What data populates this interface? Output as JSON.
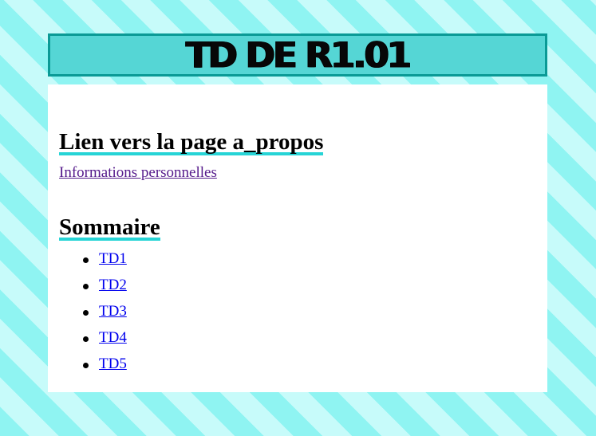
{
  "banner": {
    "title": "TD DE R1.01"
  },
  "section_link": {
    "heading": "Lien vers la page a_propos",
    "link_label": "Informations personnelles"
  },
  "summary": {
    "heading": "Sommaire",
    "items": [
      {
        "label": "TD1"
      },
      {
        "label": "TD2"
      },
      {
        "label": "TD3"
      },
      {
        "label": "TD4"
      },
      {
        "label": "TD5"
      }
    ]
  },
  "colors": {
    "stripe_dark": "#8ff4f2",
    "stripe_light": "#c7fbfa",
    "banner_bg": "#55d6d5",
    "banner_border": "#0a9a96",
    "heading_underline": "#27d4d6",
    "visited_link": "#551a8b",
    "link": "#0000ee"
  }
}
